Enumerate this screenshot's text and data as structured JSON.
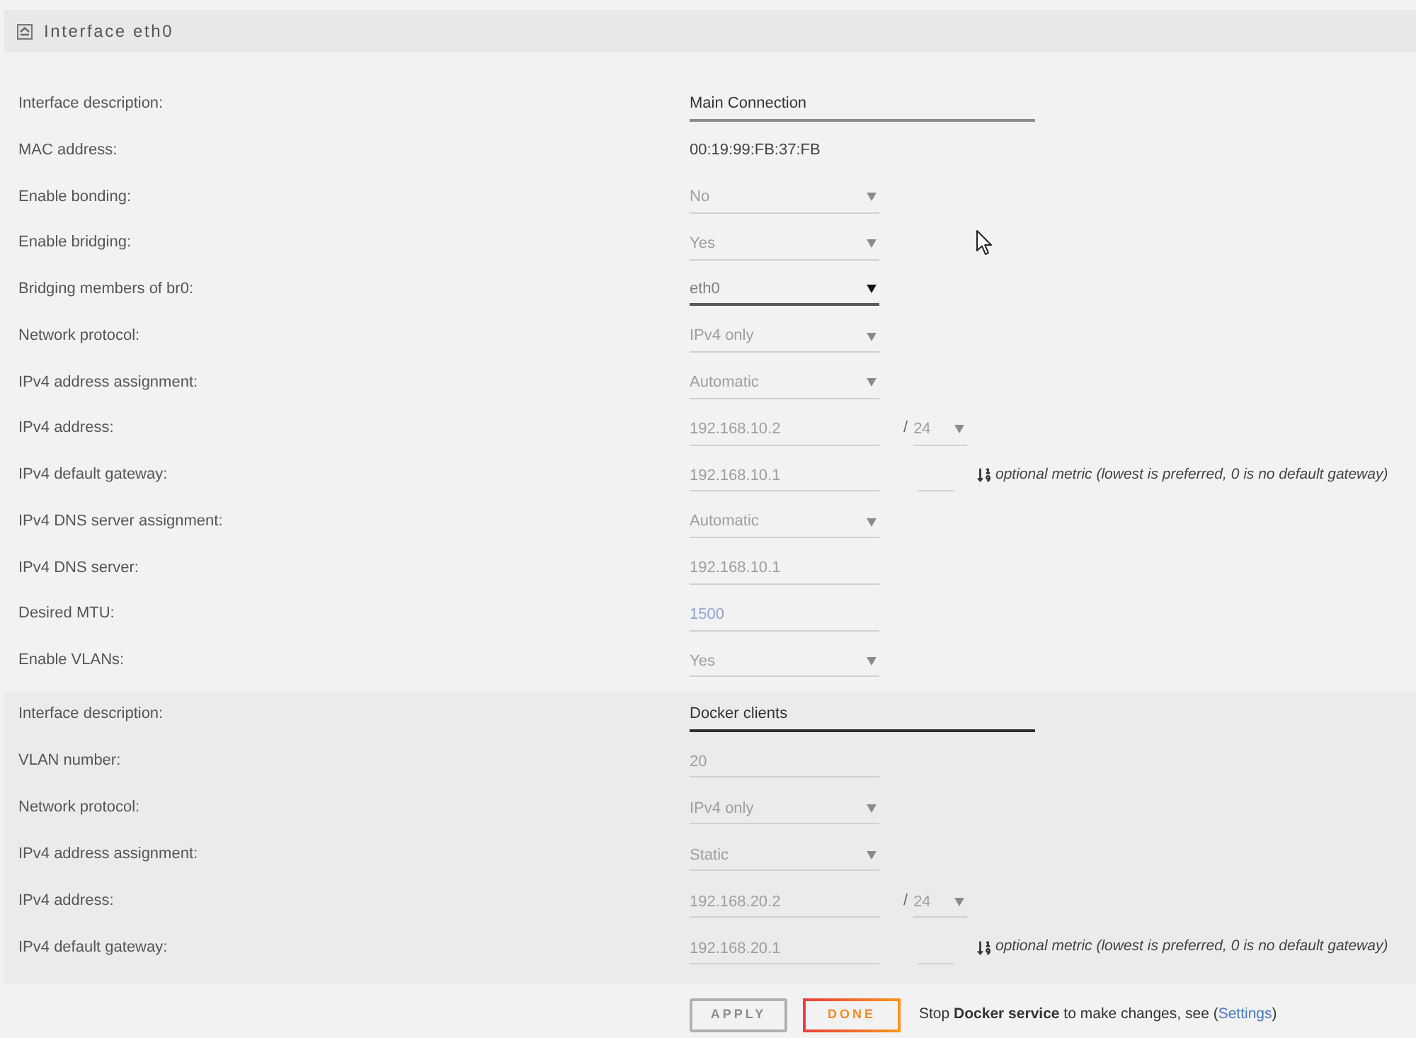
{
  "header": {
    "title": "Interface eth0"
  },
  "sections": [
    {
      "rows": [
        {
          "label": "Interface description:",
          "kind": "text",
          "value": "Main Connection",
          "disabled": false,
          "focused": false
        },
        {
          "label": "MAC address:",
          "kind": "static",
          "value": "00:19:99:FB:37:FB"
        },
        {
          "label": "Enable bonding:",
          "kind": "select",
          "value": "No",
          "disabled": true
        },
        {
          "label": "Enable bridging:",
          "kind": "select",
          "value": "Yes",
          "disabled": true
        },
        {
          "label": "Bridging members of br0:",
          "kind": "select",
          "value": "eth0",
          "disabled": false
        },
        {
          "label": "Network protocol:",
          "kind": "select",
          "value": "IPv4 only",
          "disabled": true
        },
        {
          "label": "IPv4 address assignment:",
          "kind": "select",
          "value": "Automatic",
          "disabled": true
        },
        {
          "label": "IPv4 address:",
          "kind": "address",
          "value": "192.168.10.2",
          "disabled": true,
          "prefix": {
            "separator": "/",
            "value": "24",
            "disabled": true
          }
        },
        {
          "label": "IPv4 default gateway:",
          "kind": "gateway",
          "value": "192.168.10.1",
          "disabled": true,
          "metric": {
            "disabled": true
          },
          "hint": "optional metric (lowest is preferred, 0 is no default gateway)"
        },
        {
          "label": "IPv4 DNS server assignment:",
          "kind": "select",
          "value": "Automatic",
          "disabled": true
        },
        {
          "label": "IPv4 DNS server:",
          "kind": "input",
          "value": "192.168.10.1",
          "disabled": true
        },
        {
          "label": "Desired MTU:",
          "kind": "input",
          "placeholder": "1500",
          "disabled": true
        },
        {
          "label": "Enable VLANs:",
          "kind": "select",
          "value": "Yes",
          "disabled": true
        }
      ]
    },
    {
      "rows": [
        {
          "label": "Interface description:",
          "kind": "text",
          "value": "Docker clients",
          "disabled": false,
          "focused": true
        },
        {
          "label": "VLAN number:",
          "kind": "input",
          "value": "20",
          "disabled": true
        },
        {
          "label": "Network protocol:",
          "kind": "select",
          "value": "IPv4 only",
          "disabled": true
        },
        {
          "label": "IPv4 address assignment:",
          "kind": "select",
          "value": "Static",
          "disabled": true
        },
        {
          "label": "IPv4 address:",
          "kind": "address",
          "value": "192.168.20.2",
          "disabled": true,
          "prefix": {
            "separator": "/",
            "value": "24",
            "disabled": true
          }
        },
        {
          "label": "IPv4 default gateway:",
          "kind": "gateway",
          "value": "192.168.20.1",
          "disabled": true,
          "metric": {
            "disabled": true
          },
          "hint": "optional metric (lowest is preferred, 0 is no default gateway)"
        }
      ]
    }
  ],
  "footer": {
    "buttons": [
      {
        "label": "APPLY",
        "disabled": true
      },
      {
        "label": "DONE",
        "disabled": false
      }
    ],
    "note": {
      "text": "Stop **Docker service** to make changes, see (",
      "link": "Settings",
      "text_after": ")"
    }
  }
}
